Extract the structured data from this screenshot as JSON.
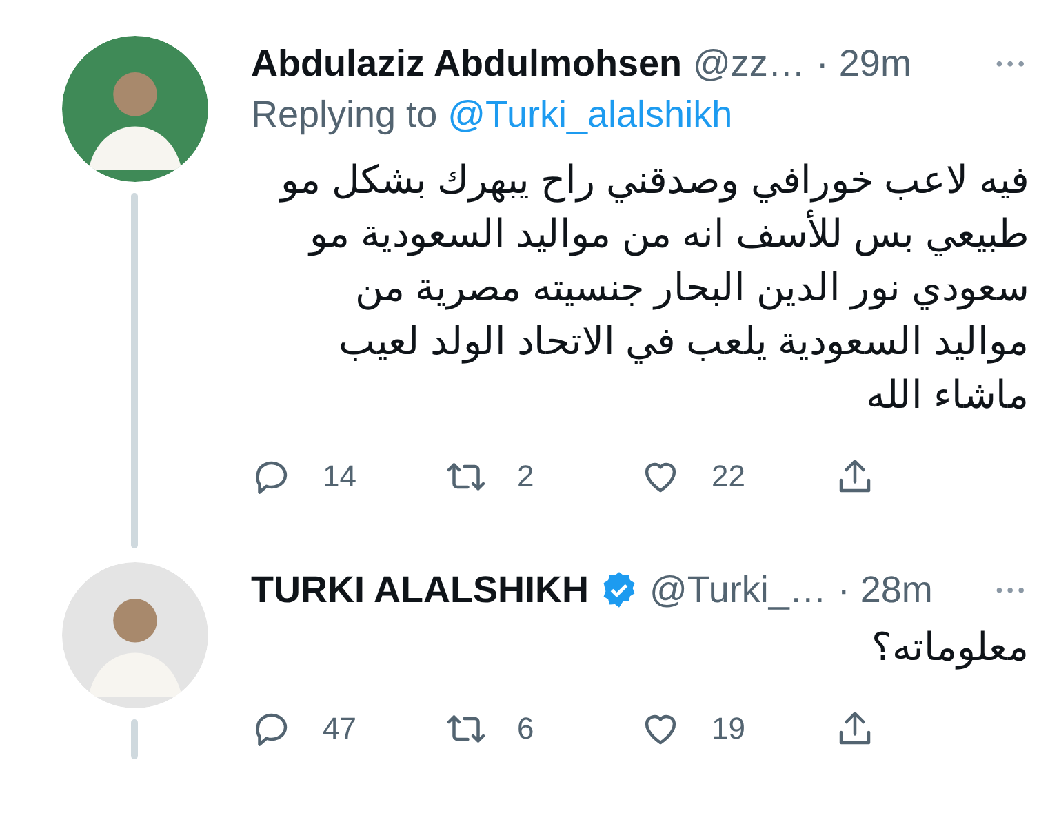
{
  "tweets": [
    {
      "name": "Abdulaziz Abdulmohsen",
      "verified": false,
      "handle": "@zz…",
      "time": "· 29m",
      "more": "•••",
      "replying_prefix": "Replying to",
      "replying_to": "@Turki_alalshikh",
      "text": "فيه لاعب خورافي وصدقني راح يبهرك بشكل مو طبيعي بس للأسف انه من مواليد السعودية مو سعودي نور الدين البحار جنسيته مصرية من مواليد السعودية يلعب في الاتحاد الولد لعيب ماشاء الله",
      "replies": "14",
      "retweets": "2",
      "likes": "22",
      "thread_below": true
    },
    {
      "name": "TURKI ALALSHIKH",
      "verified": true,
      "handle": "@Turki_…",
      "time": "· 28m",
      "more": "•••",
      "text": "معلوماته؟",
      "replies": "47",
      "retweets": "6",
      "likes": "19",
      "thread_below": true
    }
  ]
}
